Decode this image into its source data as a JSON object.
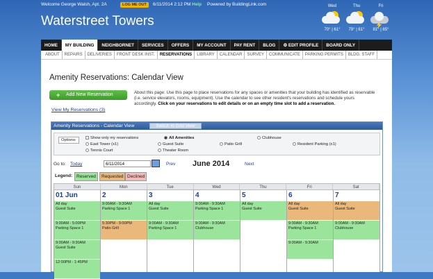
{
  "topbar": {
    "welcome": "Welcome George Walsh, Apt. 2A",
    "logout": "LOG ME OUT",
    "datetime": "6/11/2014 2:12 PM",
    "help": "Help",
    "powered": "Powered by BuildingLink.com"
  },
  "site_title": "Waterstreet Towers",
  "weather": [
    {
      "day": "Wed",
      "temps": "70° | 61°",
      "icon": "partly-cloudy-icon"
    },
    {
      "day": "Thu",
      "temps": "79° | 61°",
      "icon": "partly-cloudy-icon"
    },
    {
      "day": "Fri",
      "temps": "81° | 65°",
      "icon": "thunderstorm-icon"
    }
  ],
  "nav": [
    "HOME",
    "MY BUILDING",
    "NEIGHBORNET",
    "SERVICES",
    "OFFERS",
    "MY ACCOUNT",
    "PAY RENT",
    "BLOG",
    "EDIT PROFILE",
    "BOARD ONLY"
  ],
  "subnav": [
    "ABOUT",
    "REPAIRS",
    "DELIVERIES",
    "FRONT DESK INST.",
    "RESERVATIONS",
    "LIBRARY",
    "CALENDAR",
    "SURVEY",
    "COMMUNICATE",
    "PARKING PERMITS",
    "BLDG. STAFF"
  ],
  "page_title": "Amenity Reservations: Calendar View",
  "add_button": "Add New Reservation",
  "about_text": "About this page: Use this page to place reservations for any spaces or amenities that your building has identified as reservable (i.e. service elevators, rooms, equipment). Use the calendar to see other resident's reservations and schedule yours accordingly.",
  "about_bold": "Click on your reservations to edit details or on an empty time slot to add a reservation.",
  "view_link": "View My Reservations (3)",
  "calendar": {
    "header": "Amenity Reservations - Calendar View",
    "switch_btn": "Switch to Grid View",
    "options_label": "Options:",
    "opt_show_mine": "Show only my reservations",
    "opt_all": "All Amenities",
    "opt_clubhouse": "Clubhouse",
    "opt_east_tower": "East Tower (x1)",
    "opt_guest_suite": "Guest Suite",
    "opt_patio": "Patio Grill",
    "opt_resident_parking": "Resident Parking  (x1)",
    "opt_tennis": "Tennis Court",
    "opt_theater": "Theater Room",
    "goto_label": "Go to:",
    "today": "Today",
    "date_value": "6/11/2014",
    "prev": "Prev",
    "month": "June 2014",
    "next": "Next",
    "legend_label": "Legend:",
    "legend_reserved": "Reserved",
    "legend_requested": "Requested",
    "legend_declined": "Declined",
    "weekdays": [
      "Sun",
      "Mon",
      "Tue",
      "Wed",
      "Thu",
      "Fri",
      "Sat"
    ],
    "days": [
      {
        "num": "01 Jun",
        "events": [
          {
            "t": "All day",
            "n": "Guest Suite",
            "s": "res"
          },
          {
            "t": "9:00AM - 5:00PM",
            "n": "Parking Space 1",
            "s": "res"
          },
          {
            "t": "9:00AM - 9:30AM",
            "n": "Guest Suite",
            "s": "res"
          },
          {
            "t": "12:00PM - 1:45PM",
            "n": "",
            "s": "res"
          }
        ]
      },
      {
        "num": "2",
        "events": [
          {
            "t": "9:00AM - 9:30AM",
            "n": "Parking Space 1",
            "s": "res"
          },
          {
            "t": "5:30PM - 9:00PM",
            "n": "Patio Grill",
            "s": "req"
          }
        ]
      },
      {
        "num": "3",
        "events": [
          {
            "t": "All day",
            "n": "Guest Suite",
            "s": "res"
          },
          {
            "t": "9:00AM - 9:30AM",
            "n": "Parking Space 1",
            "s": "res"
          }
        ]
      },
      {
        "num": "4",
        "events": [
          {
            "t": "9:00AM - 9:30AM",
            "n": "Parking Space 1",
            "s": "res"
          },
          {
            "t": "9:00AM - 9:30AM",
            "n": "Clubhouse",
            "s": "res"
          }
        ]
      },
      {
        "num": "5",
        "events": [
          {
            "t": "All day",
            "n": "Guest Suite",
            "s": "res"
          }
        ]
      },
      {
        "num": "6",
        "events": [
          {
            "t": "All day",
            "n": "Guest Suite",
            "s": "req"
          },
          {
            "t": "9:00AM - 9:30AM",
            "n": "Parking Space 1",
            "s": "res"
          },
          {
            "t": "9:00AM - 9:30AM",
            "n": "",
            "s": "res"
          }
        ]
      },
      {
        "num": "7",
        "events": [
          {
            "t": "All day",
            "n": "Guest Suite",
            "s": "req"
          },
          {
            "t": "9:00AM - 9:30AM",
            "n": "Clubhouse",
            "s": "res"
          }
        ]
      }
    ]
  }
}
